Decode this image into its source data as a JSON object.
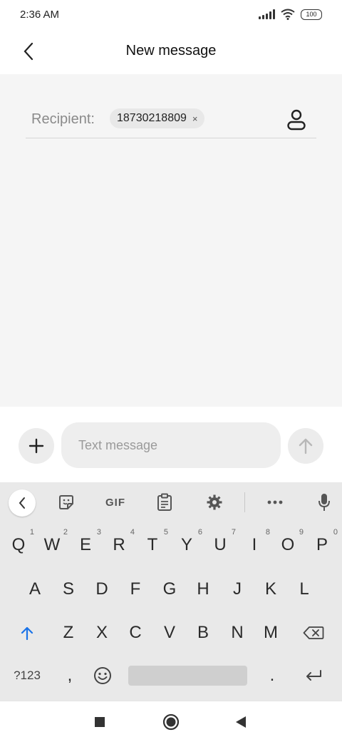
{
  "status_bar": {
    "time": "2:36 AM",
    "battery": "100",
    "icons": [
      "signal-icon",
      "wifi-icon",
      "battery-icon"
    ]
  },
  "header": {
    "title": "New message",
    "back_icon": "chevron-left-icon"
  },
  "recipient": {
    "label": "Recipient:",
    "chip": "18730218809",
    "chip_remove": "×",
    "contact_icon": "person-icon"
  },
  "compose": {
    "placeholder": "Text message",
    "attach_icon": "plus-icon",
    "send_icon": "arrow-up-icon"
  },
  "keyboard": {
    "toolbar": {
      "gif_label": "GIF",
      "icons": [
        "chevron-left-icon",
        "sticker-icon",
        "gif-icon",
        "clipboard-icon",
        "gear-icon",
        "more-icon",
        "mic-icon"
      ]
    },
    "row1": [
      {
        "key": "Q",
        "hint": "1"
      },
      {
        "key": "W",
        "hint": "2"
      },
      {
        "key": "E",
        "hint": "3"
      },
      {
        "key": "R",
        "hint": "4"
      },
      {
        "key": "T",
        "hint": "5"
      },
      {
        "key": "Y",
        "hint": "6"
      },
      {
        "key": "U",
        "hint": "7"
      },
      {
        "key": "I",
        "hint": "8"
      },
      {
        "key": "O",
        "hint": "9"
      },
      {
        "key": "P",
        "hint": "0"
      }
    ],
    "row2": [
      "A",
      "S",
      "D",
      "F",
      "G",
      "H",
      "J",
      "K",
      "L"
    ],
    "row3": [
      "Z",
      "X",
      "C",
      "V",
      "B",
      "N",
      "M"
    ],
    "row4": {
      "symbols": "?123",
      "comma": ",",
      "period": "."
    },
    "accent_color": "#1a73e8"
  },
  "nav_bar": {
    "icons": [
      "recents-icon",
      "home-icon",
      "back-icon"
    ]
  }
}
